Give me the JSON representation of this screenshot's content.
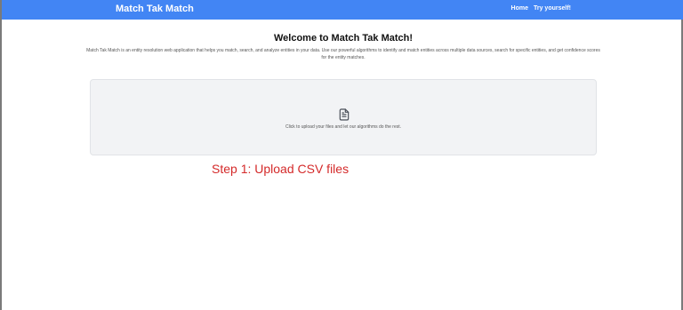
{
  "navbar": {
    "brand": "Match Tak Match",
    "links": [
      "Home",
      "Try yourself!"
    ],
    "color": "#4285f4"
  },
  "main": {
    "title": "Welcome to Match Tak Match!",
    "intro": "Match Tak Match is an entity resolution web application that helps you match, search, and analyze entities in your data. Use our powerful algorithms to identify and match entities across multiple data sources, search for specific entities, and get confidence scores for the entity matches."
  },
  "upload": {
    "icon": "file-document-icon",
    "hint": "Click to upload your files and let our algorithms do the rest."
  },
  "annotation": {
    "text": "Step 1: Upload CSV files",
    "color": "#d42a2a"
  }
}
